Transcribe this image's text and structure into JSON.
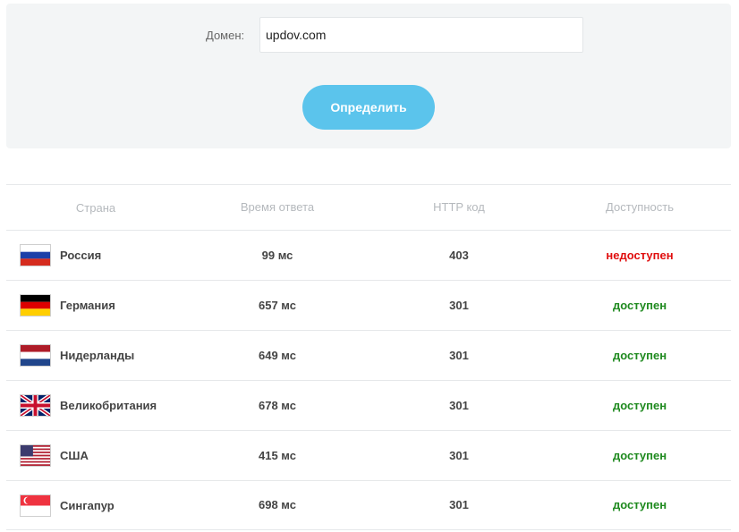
{
  "form": {
    "domain_label": "Домен:",
    "domain_value": "updov.com",
    "submit_label": "Определить"
  },
  "table": {
    "headers": {
      "country": "Страна",
      "time": "Время ответа",
      "code": "HTTP код",
      "status": "Доступность"
    },
    "rows": [
      {
        "flag": "russia-flag-icon",
        "country": "Россия",
        "time": "99 мс",
        "code": "403",
        "status": "недоступен",
        "status_color": "#e00d0d"
      },
      {
        "flag": "germany-flag-icon",
        "country": "Германия",
        "time": "657 мс",
        "code": "301",
        "status": "доступен",
        "status_color": "#1f8a1f"
      },
      {
        "flag": "netherlands-flag-icon",
        "country": "Нидерланды",
        "time": "649 мс",
        "code": "301",
        "status": "доступен",
        "status_color": "#1f8a1f"
      },
      {
        "flag": "uk-flag-icon",
        "country": "Великобритания",
        "time": "678 мс",
        "code": "301",
        "status": "доступен",
        "status_color": "#1f8a1f"
      },
      {
        "flag": "usa-flag-icon",
        "country": "США",
        "time": "415 мс",
        "code": "301",
        "status": "доступен",
        "status_color": "#1f8a1f"
      },
      {
        "flag": "singapore-flag-icon",
        "country": "Сингапур",
        "time": "698 мс",
        "code": "301",
        "status": "доступен",
        "status_color": "#1f8a1f"
      }
    ]
  },
  "colors": {
    "accent": "#5bc4ec",
    "available": "#1f8a1f",
    "unavailable": "#e00d0d"
  }
}
